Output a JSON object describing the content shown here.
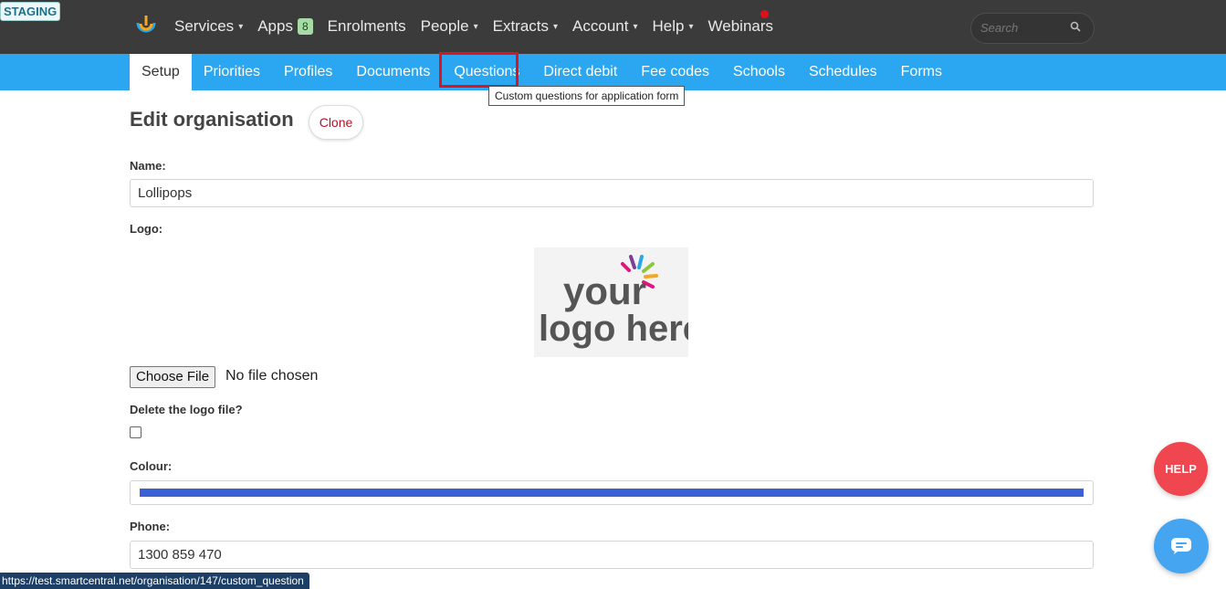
{
  "env_badge": "STAGING",
  "topnav": {
    "items": [
      {
        "label": "Services",
        "has_caret": true
      },
      {
        "label": "Apps",
        "badge": "8"
      },
      {
        "label": "Enrolments"
      },
      {
        "label": "People",
        "has_caret": true
      },
      {
        "label": "Extracts",
        "has_caret": true
      },
      {
        "label": "Account",
        "has_caret": true
      },
      {
        "label": "Help",
        "has_caret": true
      },
      {
        "label": "Webinars"
      }
    ],
    "caret": "▾",
    "search_placeholder": "Search",
    "notification_color": "#e0101a"
  },
  "subnav": {
    "tabs": [
      "Setup",
      "Priorities",
      "Profiles",
      "Documents",
      "Questions",
      "Direct debit",
      "Fee codes",
      "Schools",
      "Schedules",
      "Forms"
    ],
    "active_tab": "Setup",
    "highlighted_tab": "Questions",
    "tooltip": "Custom questions for application form"
  },
  "page": {
    "title": "Edit organisation",
    "clone_label": "Clone"
  },
  "form": {
    "name_label": "Name:",
    "name_value": "Lollipops",
    "logo_label": "Logo:",
    "logo_text_top": "your",
    "logo_text_bottom": "logo here",
    "choose_file_label": "Choose File",
    "no_file_text": "No file chosen",
    "delete_logo_label": "Delete the logo file?",
    "delete_logo_checked": false,
    "colour_label": "Colour:",
    "colour_value": "#3b5fd4",
    "phone_label": "Phone:",
    "phone_value": "1300 859 470"
  },
  "widgets": {
    "help_label": "HELP",
    "chat_icon": "chat-bubble-icon"
  },
  "status_bar_url": "https://test.smartcentral.net/organisation/147/custom_question",
  "colors": {
    "topbar": "#3b3b3b",
    "subbar": "#2ba6f0",
    "highlight": "#e0121d",
    "help_button": "#ef4650",
    "chat_button": "#46a5f0"
  }
}
